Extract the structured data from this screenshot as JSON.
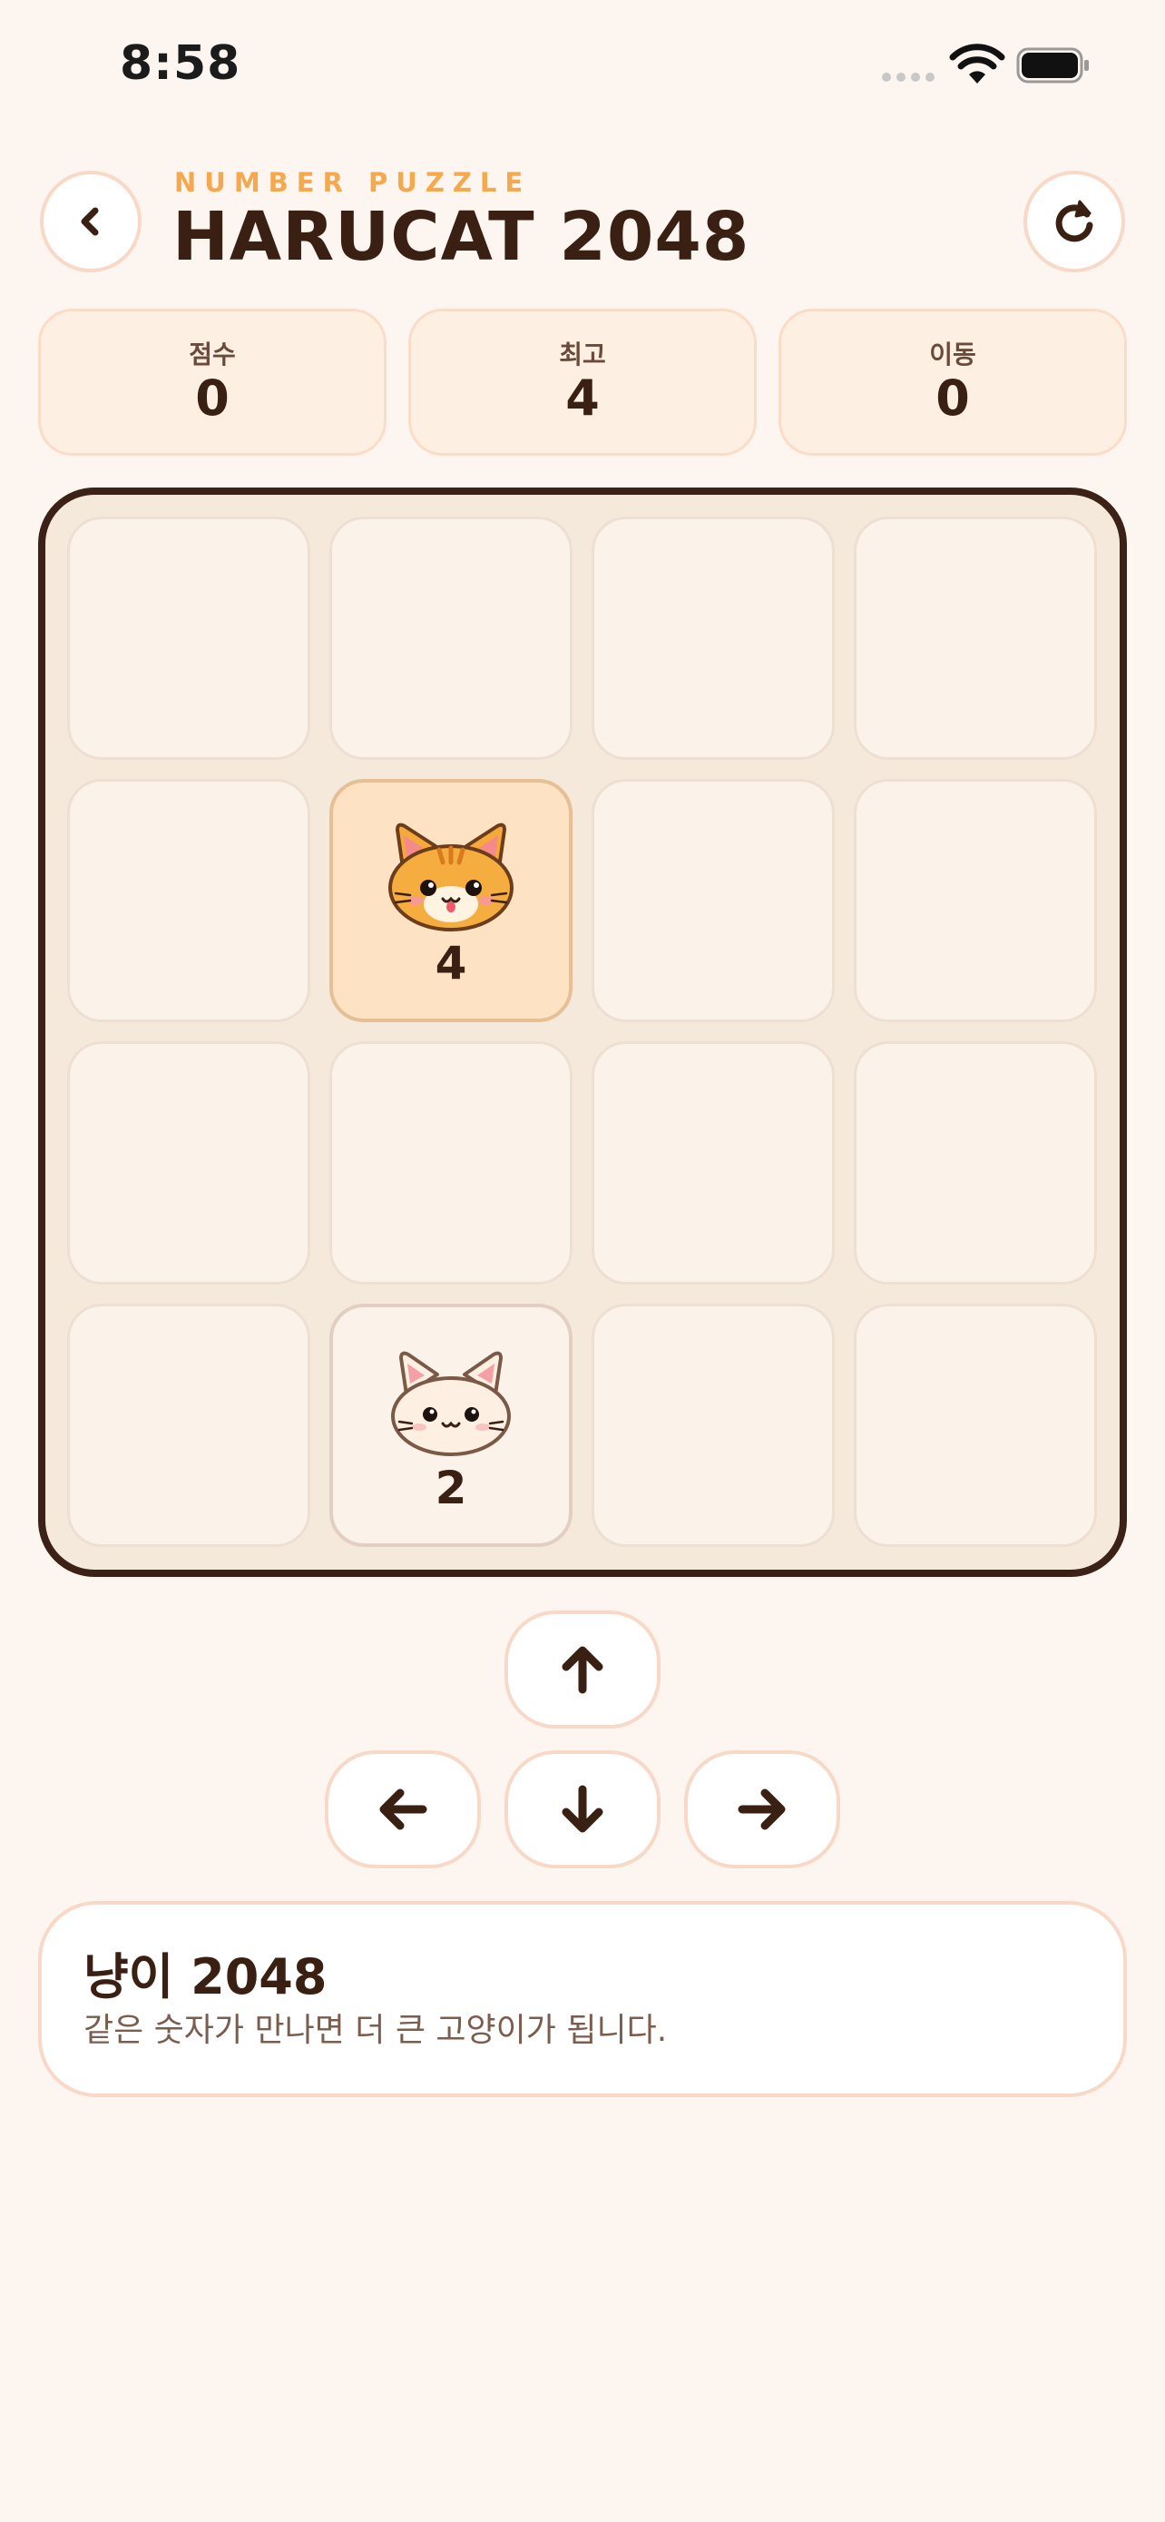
{
  "status_bar": {
    "time": "8:58"
  },
  "header": {
    "subtitle": "NUMBER PUZZLE",
    "title": "HARUCAT 2048",
    "back_icon": "chevron-left-icon",
    "refresh_icon": "refresh-icon"
  },
  "stats": [
    {
      "label": "점수",
      "value": "0"
    },
    {
      "label": "최고",
      "value": "4"
    },
    {
      "label": "이동",
      "value": "0"
    }
  ],
  "board": {
    "size": 4,
    "tiles": [
      {
        "row": 2,
        "col": 2,
        "value": "4",
        "cat": "orange-tabby-cat-icon"
      },
      {
        "row": 4,
        "col": 2,
        "value": "2",
        "cat": "white-cat-icon"
      }
    ]
  },
  "controls": {
    "up_icon": "arrow-up-icon",
    "left_icon": "arrow-left-icon",
    "down_icon": "arrow-down-icon",
    "right_icon": "arrow-right-icon"
  },
  "info": {
    "title": "냥이 2048",
    "description": "같은 숫자가 만나면 더 큰 고양이가 됩니다."
  },
  "colors": {
    "background": "#fdf5ef",
    "accent": "#f4a94f",
    "text_dark": "#3a1f13",
    "board_border": "#3b2116"
  }
}
